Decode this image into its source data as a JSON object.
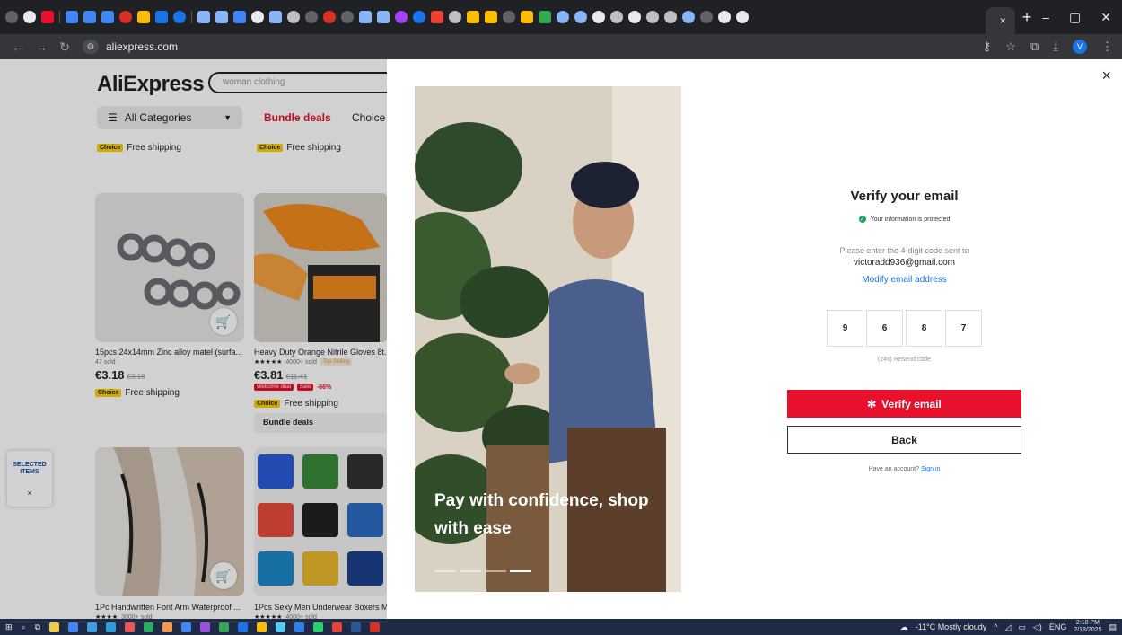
{
  "browser": {
    "active_tab_label": "",
    "address": "aliexpress.com",
    "profile_initial": "V"
  },
  "header": {
    "logo": "AliExpress",
    "search_placeholder": "woman clothing",
    "categories_label": "All Categories",
    "nav": {
      "bundle": "Bundle deals",
      "choice": "Choice"
    }
  },
  "products": {
    "shipping": "Free shipping",
    "choice_badge": "Choice",
    "items": [
      {
        "title": "15pcs 24x14mm Zinc alloy matel (surfa...",
        "sold": "47 sold",
        "price": "€3.18",
        "old_price": "€3.18"
      },
      {
        "title": "Heavy Duty Orange Nitrile Gloves 8t...",
        "sold": "4000+ sold",
        "top_selling": "Top Selling",
        "price": "€3.81",
        "old_price": "€11.41",
        "welcome": "Welcome deal",
        "sale": "Sale",
        "off": "-66%",
        "bundle": "Bundle deals"
      },
      {
        "title": "1Pc Handwritten Font Arm Waterproof ...",
        "sold": "3000+ sold"
      },
      {
        "title": "1Pcs Sexy Men Underwear Boxers M...",
        "sold": "4000+ sold"
      }
    ]
  },
  "widget": {
    "line1": "SELECTED",
    "line2": "ITEMS",
    "close": "×"
  },
  "modal": {
    "close": "×",
    "caption": "Pay with confidence, shop with ease",
    "title": "Verify your email",
    "protected": "Your information is protected",
    "desc": "Please enter the 4-digit code sent to",
    "email": "victoradd936@gmail.com",
    "modify": "Modify email address",
    "code": [
      "9",
      "6",
      "8",
      "7"
    ],
    "resend": "(24s) Resend code",
    "verify_label": "Verify email",
    "back_label": "Back",
    "have_account": "Have an account?",
    "sign_in": "Sign in"
  },
  "taskbar": {
    "weather": "-11°C Mostly cloudy",
    "lang": "ENG",
    "time": "2:18 PM",
    "date": "2/18/2025"
  },
  "colors": {
    "accent": "#e8112d",
    "link": "#1a73e8",
    "choice": "#fed000"
  }
}
